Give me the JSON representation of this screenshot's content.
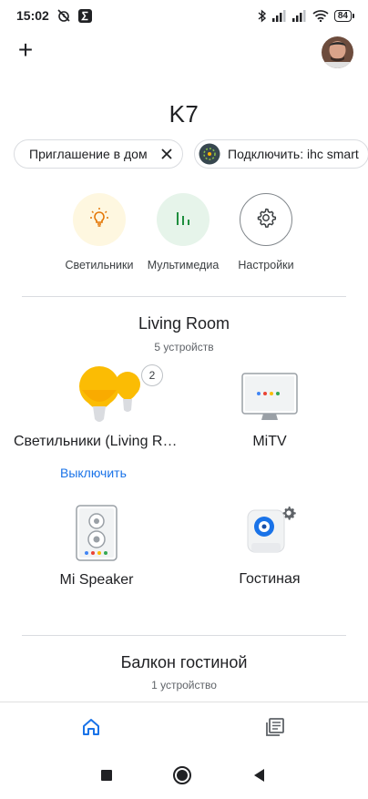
{
  "status_bar": {
    "time": "15:02",
    "battery": "84"
  },
  "top_bar": {
    "add_label": "+"
  },
  "home": {
    "title": "K7"
  },
  "chips": [
    {
      "label": "Приглашение в дом"
    },
    {
      "label": "Подключить: ihc smart"
    }
  ],
  "shortcuts": [
    {
      "label": "Светильники",
      "color": "#fef7e0",
      "icon": "lightbulb-icon"
    },
    {
      "label": "Мультимедиа",
      "color": "#e6f4ea",
      "icon": "equalizer-icon"
    },
    {
      "label": "Настройки",
      "color": "#ffffff",
      "icon": "gear-icon"
    }
  ],
  "rooms": [
    {
      "name": "Living Room",
      "subtitle": "5 устройств",
      "devices": [
        {
          "name": "Светильники (Living Room)",
          "badge": "2",
          "action": "Выключить",
          "icon": "light-group-icon"
        },
        {
          "name": "MiTV",
          "icon": "tv-icon"
        },
        {
          "name": "Mi Speaker",
          "icon": "speaker-icon"
        },
        {
          "name": "Гостиная",
          "icon": "camera-icon"
        }
      ]
    },
    {
      "name": "Балкон гостиной",
      "subtitle": "1 устройство"
    }
  ],
  "bottom_nav": [
    {
      "icon": "home-icon",
      "active": true,
      "color": "#1a73e8"
    },
    {
      "icon": "feed-icon",
      "active": false,
      "color": "#5f6368"
    }
  ]
}
